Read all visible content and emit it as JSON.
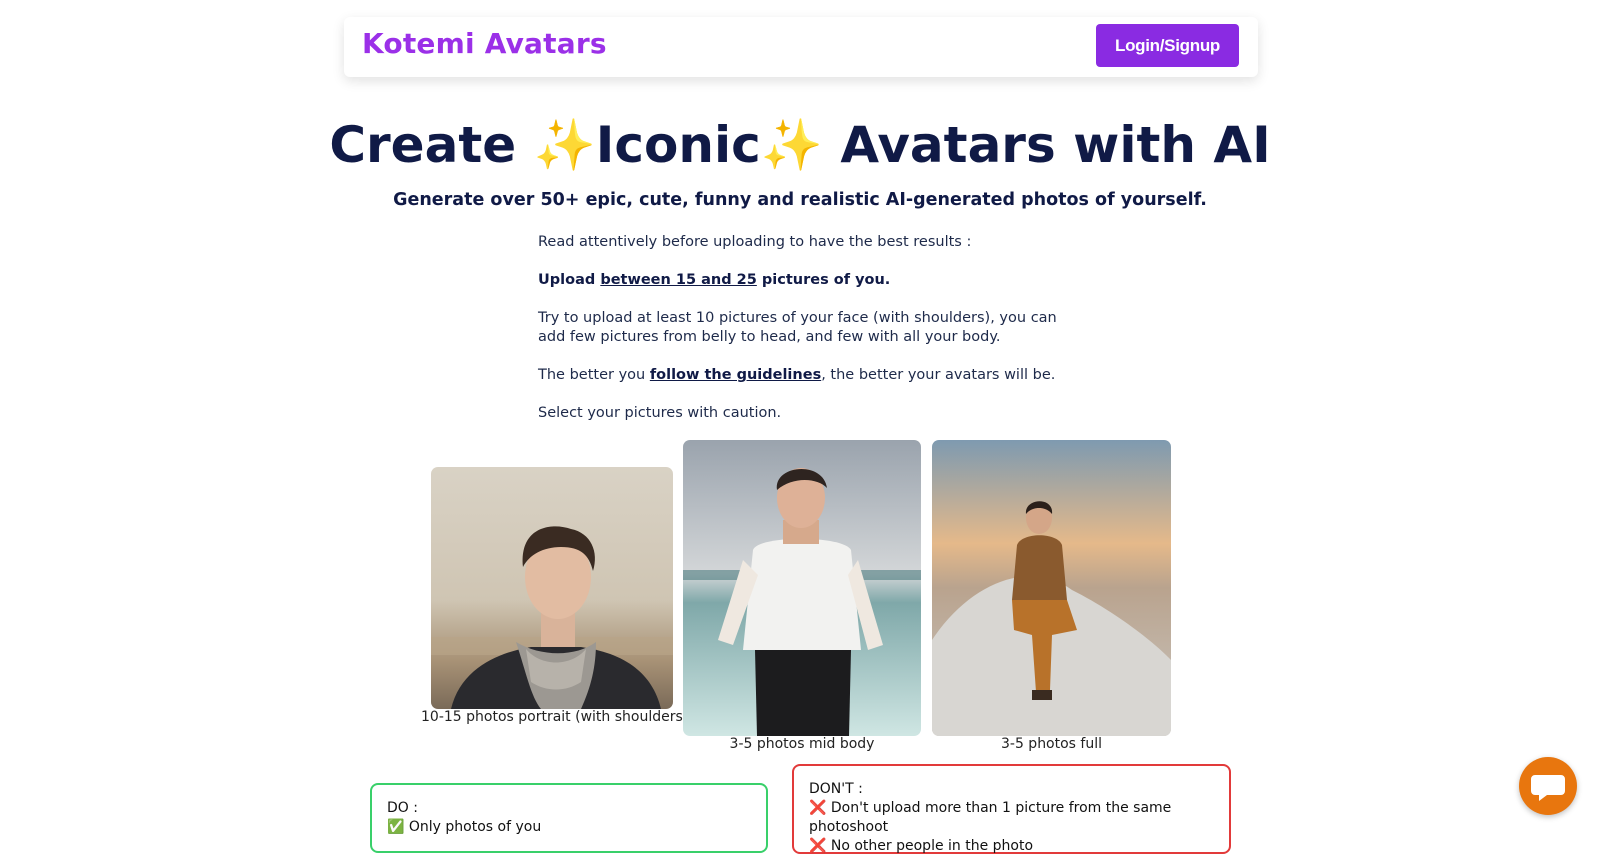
{
  "nav": {
    "brand": "Kotemi Avatars",
    "login_label": "Login/Signup"
  },
  "hero": {
    "title": "Create ✨Iconic✨ Avatars with AI",
    "subtitle": "Generate over 50+ epic, cute, funny and realistic AI-generated photos of yourself."
  },
  "instructions": {
    "intro": "Read attentively before uploading to have the best results :",
    "upload_prefix": "Upload ",
    "upload_link": "between 15 and 25",
    "upload_suffix": " pictures of you.",
    "tip": "Try to upload at least 10 pictures of your face (with shoulders), you can add few pictures from belly to head, and few with all your body.",
    "better_prefix": "The better you ",
    "better_link": "follow the guidelines",
    "better_suffix": ", the better your avatars will be.",
    "caution": "Select your pictures with caution."
  },
  "photos": [
    {
      "caption": "10-15 photos portrait (with shoulders)"
    },
    {
      "caption": "3-5 photos mid body"
    },
    {
      "caption": "3-5 photos full"
    }
  ],
  "do_box": {
    "title": "DO :",
    "items": [
      "✅ Only photos of you"
    ]
  },
  "dont_box": {
    "title": "DON'T :",
    "items": [
      "❌ Don't upload more than 1 picture from the same photoshoot",
      "❌ No other people in the photo"
    ]
  },
  "colors": {
    "brand": "#9b30e8",
    "button": "#8a2be2",
    "heading": "#101a46",
    "do_border": "#39d06a",
    "dont_border": "#e23a3a",
    "chat": "#e8760e"
  },
  "icons": {
    "chat": "chat-bubble-icon",
    "sparkles": "✨"
  }
}
